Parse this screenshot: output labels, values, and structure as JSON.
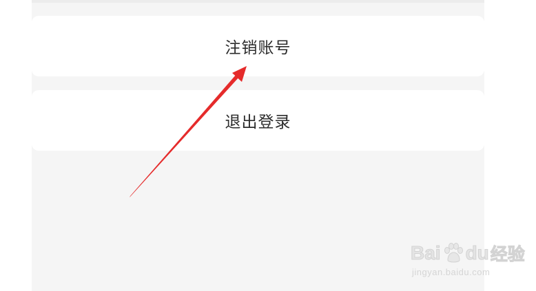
{
  "settings": {
    "deregister_label": "注销账号",
    "logout_label": "退出登录"
  },
  "annotation": {
    "color": "#e52b2b",
    "icon": "red-arrow-icon"
  },
  "watermark": {
    "brand_prefix": "Bai",
    "brand_suffix": "du",
    "brand_cn": "经验",
    "url": "jingyan.baidu.com",
    "paw_icon": "baidu-paw-icon"
  },
  "colors": {
    "background": "#f5f5f5",
    "card": "#ffffff",
    "text": "#2b2b2b"
  }
}
